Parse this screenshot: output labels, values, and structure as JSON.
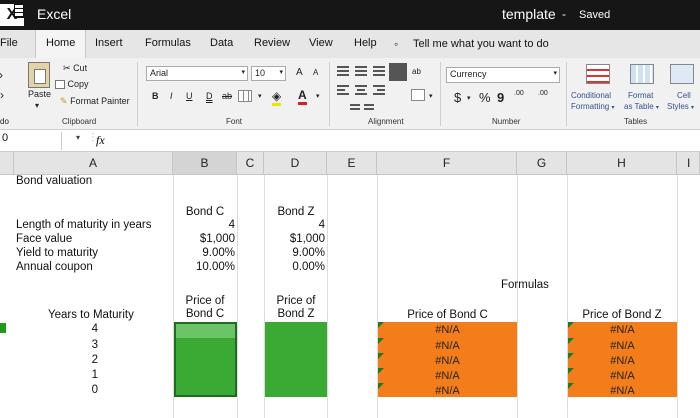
{
  "app": {
    "name": "Excel",
    "document": "template",
    "separator": "-",
    "status": "Saved"
  },
  "tabs": [
    "File",
    "Home",
    "Insert",
    "Formulas",
    "Data",
    "Review",
    "View",
    "Help"
  ],
  "tell_me": "Tell me what you want to do",
  "ribbon": {
    "clipboard": {
      "paste": "Paste",
      "cut": "Cut",
      "copy": "Copy",
      "format_painter": "Format Painter",
      "label": "Clipboard"
    },
    "font": {
      "name": "Arial",
      "size": "10",
      "grow": "A",
      "shrink": "A",
      "bold": "B",
      "italic": "I",
      "underline": "U",
      "double_underline": "D",
      "strike": "ab",
      "font_color": "A",
      "label": "Font"
    },
    "alignment": {
      "wrap": "ab",
      "label": "Alignment"
    },
    "number": {
      "format": "Currency",
      "currency": "$",
      "percent": "%",
      "comma": "9",
      "inc_decimal": ".00",
      "dec_decimal": ".00",
      "label": "Number"
    },
    "tables": {
      "conditional": "Conditional",
      "formatting": "Formatting",
      "format": "Format",
      "as_table": "as Table",
      "cell": "Cell",
      "styles": "Styles",
      "label": "Tables"
    }
  },
  "left_edge": {
    "tab": "ile",
    "paste_edge": "do"
  },
  "formula_bar": {
    "name_box": "0",
    "fx": "fx"
  },
  "columns": [
    "A",
    "B",
    "C",
    "D",
    "E",
    "F",
    "G",
    "H",
    "I"
  ],
  "sheet": {
    "title": "Bond valuation",
    "bond_c_header": "Bond C",
    "bond_z_header": "Bond Z",
    "labels": [
      "Length of maturity in years",
      "Face value",
      "Yield to maturity",
      "Annual coupon"
    ],
    "bond_c": [
      "4",
      "$1,000",
      "9.00%",
      "10.00%"
    ],
    "bond_z": [
      "4",
      "$1,000",
      "9.00%",
      "0.00%"
    ],
    "formulas_label": "Formulas",
    "years_header": "Years to Maturity",
    "price_c_header": [
      "Price of",
      "Bond C"
    ],
    "price_z_header": [
      "Price of",
      "Bond Z"
    ],
    "years": [
      "4",
      "3",
      "2",
      "1",
      "0"
    ],
    "formula_c_header": "Price of Bond C",
    "formula_z_header": "Price of Bond Z",
    "formula_c_values": [
      "#N/A",
      "#N/A",
      "#N/A",
      "#N/A",
      "#N/A"
    ],
    "formula_z_values": [
      "#N/A",
      "#N/A",
      "#N/A",
      "#N/A",
      "#N/A"
    ]
  },
  "colors": {
    "green_fill": "#3aaa35",
    "orange_fill": "#f37d1a",
    "error_triangle": "#1f7a1f"
  }
}
